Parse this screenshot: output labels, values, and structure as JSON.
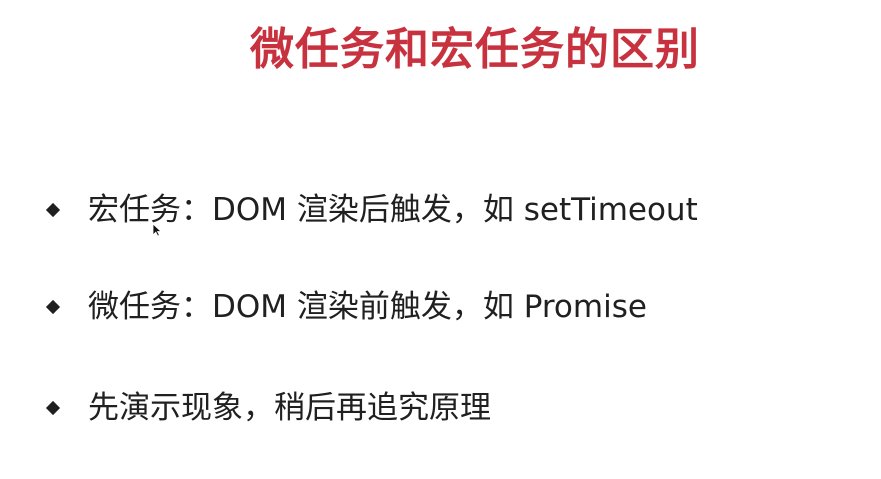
{
  "slide": {
    "title": "微任务和宏任务的区别",
    "title_color": "#c8323f",
    "bullets": [
      {
        "text": "宏任务：DOM 渲染后触发，如 setTimeout",
        "icon": "diamond-bullet-icon"
      },
      {
        "text": "微任务：DOM 渲染前触发，如 Promise",
        "icon": "diamond-bullet-icon"
      },
      {
        "text": "先演示现象，稍后再追究原理",
        "icon": "diamond-bullet-icon"
      }
    ]
  },
  "cursor": {
    "icon": "mouse-pointer-icon"
  }
}
